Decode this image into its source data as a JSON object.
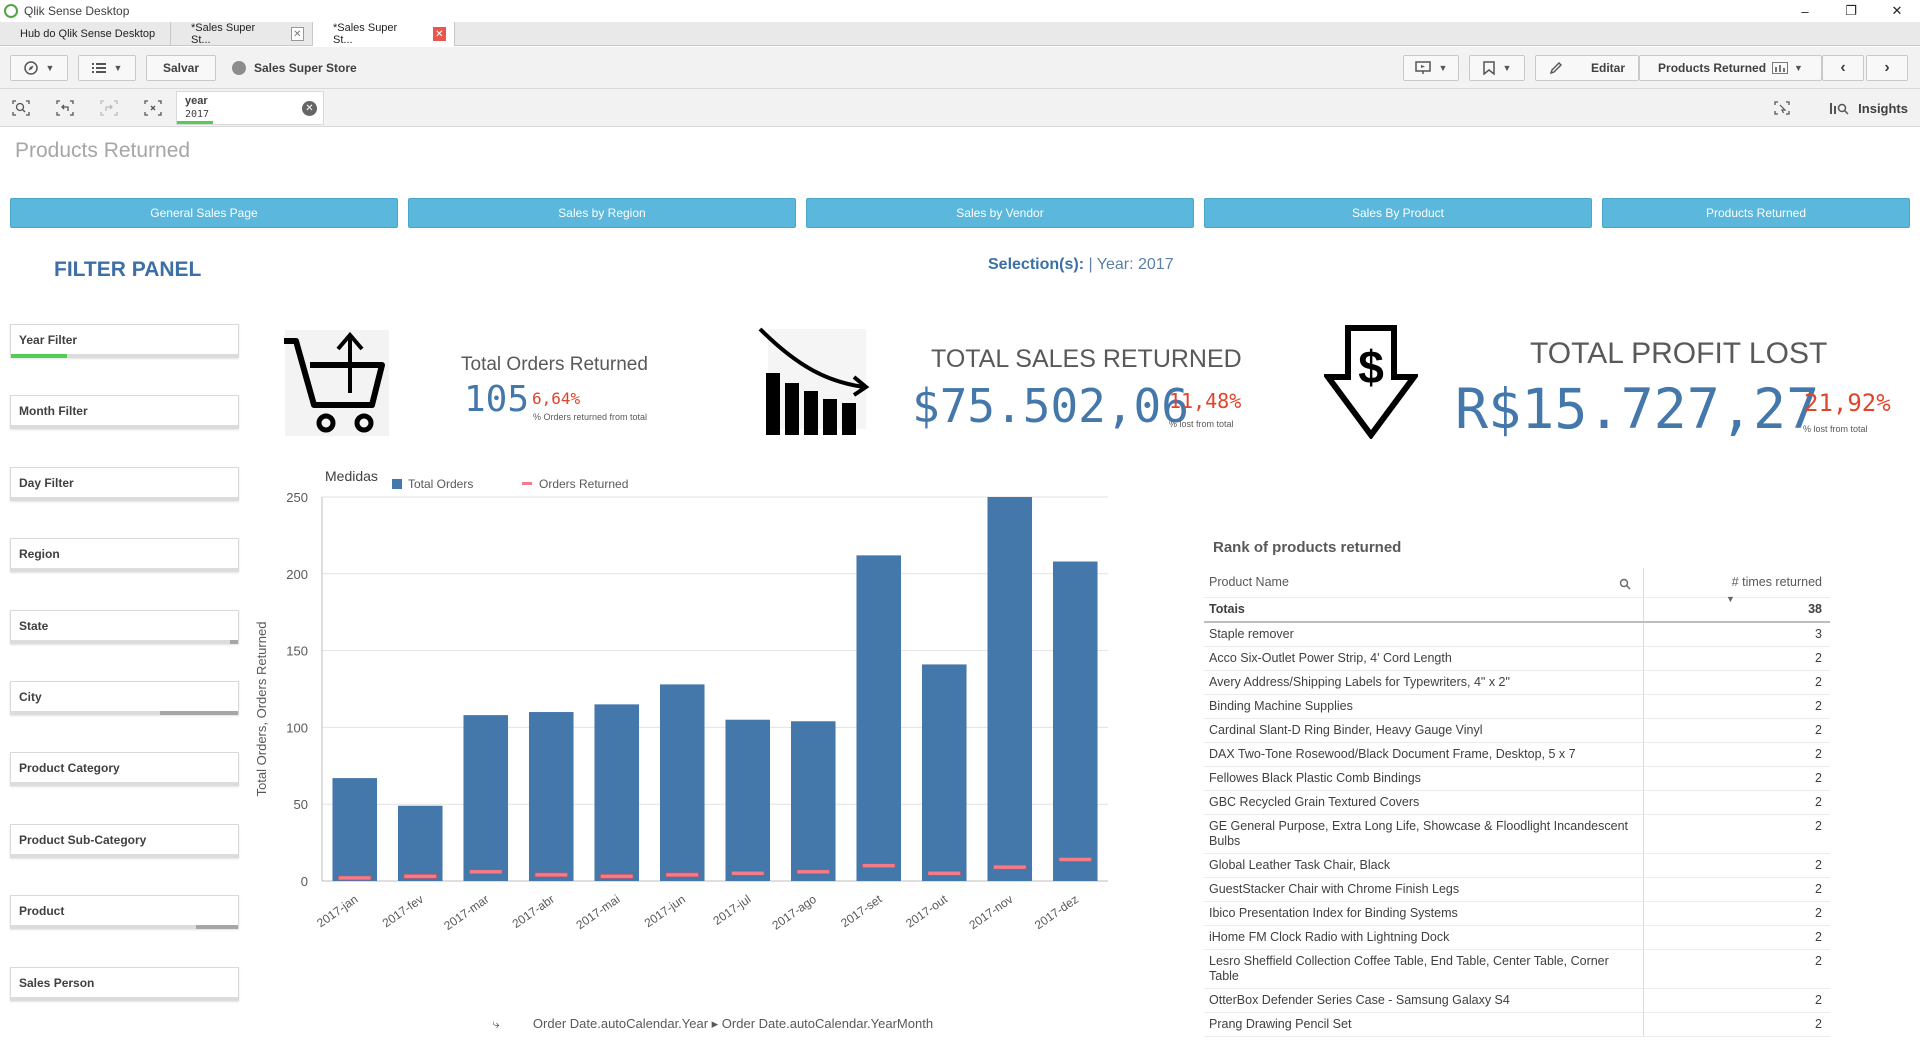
{
  "window": {
    "title": "Qlik Sense Desktop",
    "minimize": "–",
    "maximize": "❐",
    "close": "✕"
  },
  "tabs": [
    {
      "label": "Hub do Qlik Sense Desktop"
    },
    {
      "label": "*Sales Super St..."
    },
    {
      "label": "*Sales Super St..."
    }
  ],
  "toolbar": {
    "save_label": "Salvar",
    "app_name": "Sales Super Store",
    "edit_label": "Editar",
    "sheet_name": "Products Returned"
  },
  "selections": {
    "field": "year",
    "value": "2017",
    "insights_label": "Insights"
  },
  "sheet": {
    "title": "Products Returned",
    "nav_buttons": [
      {
        "label": "General Sales Page"
      },
      {
        "label": "Sales by Region"
      },
      {
        "label": "Sales by Vendor"
      },
      {
        "label": "Sales By Product"
      },
      {
        "label": "Products Returned"
      }
    ],
    "filter_panel_title": "FILTER PANEL",
    "selection_prefix": "Selection(s):",
    "selection_text": "| Year: 2017",
    "filters": [
      {
        "label": "Year Filter",
        "fill_fraction": 0.2,
        "fill_color": "#52cc52"
      },
      {
        "label": "Month Filter"
      },
      {
        "label": "Day Filter"
      },
      {
        "label": "Region"
      },
      {
        "label": "State"
      },
      {
        "label": "City"
      },
      {
        "label": "Product Category"
      },
      {
        "label": "Product Sub-Category"
      },
      {
        "label": "Product"
      },
      {
        "label": "Sales Person"
      }
    ]
  },
  "kpis": {
    "orders": {
      "label": "Total Orders Returned",
      "value": "105",
      "pct": "6,64%",
      "sub": "% Orders returned from total"
    },
    "sales": {
      "label": "TOTAL SALES RETURNED",
      "value": "$75.502,06",
      "pct": "11,48%",
      "sub": "% lost from total"
    },
    "profit": {
      "label": "TOTAL PROFIT LOST",
      "value": "R$15.727,27",
      "pct": "21,92%",
      "sub": "% lost from total"
    }
  },
  "chart_data": {
    "type": "bar",
    "title": "",
    "legend_title": "Medidas",
    "ylabel": "Total Orders, Orders Returned",
    "xlabel": "Order Date.autoCalendar.Year ▸ Order Date.autoCalendar.YearMonth",
    "ylim": [
      0,
      250
    ],
    "yticks": [
      0,
      50,
      100,
      150,
      200,
      250
    ],
    "categories": [
      "2017-jan",
      "2017-fev",
      "2017-mar",
      "2017-abr",
      "2017-mai",
      "2017-jun",
      "2017-jul",
      "2017-ago",
      "2017-set",
      "2017-out",
      "2017-nov",
      "2017-dez"
    ],
    "series": [
      {
        "name": "Total Orders",
        "type": "bar",
        "color": "#4477aa",
        "values": [
          67,
          49,
          108,
          110,
          115,
          128,
          105,
          104,
          212,
          141,
          250,
          208
        ]
      },
      {
        "name": "Orders Returned",
        "type": "marker",
        "color": "#f27c8a",
        "values": [
          2,
          3,
          6,
          4,
          3,
          4,
          5,
          6,
          10,
          5,
          9,
          14
        ]
      }
    ],
    "grid": true,
    "legend_position": "top-left"
  },
  "rank_table": {
    "title": "Rank of products returned",
    "columns": [
      "Product Name",
      "# times returned"
    ],
    "total_label": "Totais",
    "total_value": "38",
    "rows": [
      [
        "Staple remover",
        "3"
      ],
      [
        "Acco Six-Outlet Power Strip, 4' Cord Length",
        "2"
      ],
      [
        "Avery Address/Shipping Labels for Typewriters, 4\" x 2\"",
        "2"
      ],
      [
        "Binding Machine Supplies",
        "2"
      ],
      [
        "Cardinal Slant-D Ring Binder, Heavy Gauge Vinyl",
        "2"
      ],
      [
        "DAX Two-Tone Rosewood/Black Document Frame, Desktop, 5 x 7",
        "2"
      ],
      [
        "Fellowes Black Plastic Comb Bindings",
        "2"
      ],
      [
        "GBC Recycled Grain Textured Covers",
        "2"
      ],
      [
        "GE General Purpose, Extra Long Life, Showcase & Floodlight Incandescent Bulbs",
        "2"
      ],
      [
        "Global Leather Task Chair, Black",
        "2"
      ],
      [
        "GuestStacker Chair with Chrome Finish Legs",
        "2"
      ],
      [
        "Ibico Presentation Index for Binding Systems",
        "2"
      ],
      [
        "iHome FM Clock Radio with Lightning Dock",
        "2"
      ],
      [
        "Lesro Sheffield Collection Coffee Table, End Table, Center Table, Corner Table",
        "2"
      ],
      [
        "OtterBox Defender Series Case - Samsung Galaxy S4",
        "2"
      ],
      [
        "Prang Drawing Pencil Set",
        "2"
      ]
    ]
  }
}
